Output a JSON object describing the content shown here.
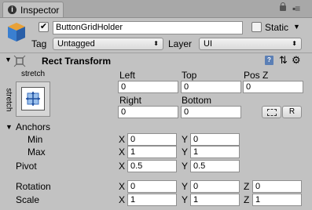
{
  "window": {
    "tab_title": "Inspector",
    "tab_icon": "info-icon",
    "menu_icon": "kebab-menu-icon"
  },
  "gameobject": {
    "active": true,
    "name": "ButtonGridHolder",
    "static_label": "Static",
    "static_checked": false,
    "tag_label": "Tag",
    "tag_value": "Untagged",
    "layer_label": "Layer",
    "layer_value": "UI"
  },
  "rect_transform": {
    "title": "Rect Transform",
    "anchor_preset_h": "stretch",
    "anchor_preset_v": "stretch",
    "headers": {
      "left": "Left",
      "top": "Top",
      "posz": "Pos Z",
      "right": "Right",
      "bottom": "Bottom"
    },
    "values": {
      "left": "0",
      "top": "0",
      "posz": "0",
      "right": "0",
      "bottom": "0"
    },
    "raw_button": "R",
    "anchors": {
      "label": "Anchors",
      "min_label": "Min",
      "min_x": "0",
      "min_y": "0",
      "max_label": "Max",
      "max_x": "1",
      "max_y": "1"
    },
    "pivot": {
      "label": "Pivot",
      "x": "0.5",
      "y": "0.5"
    },
    "rotation": {
      "label": "Rotation",
      "x": "0",
      "y": "0",
      "z": "0"
    },
    "scale": {
      "label": "Scale",
      "x": "1",
      "y": "1",
      "z": "1"
    },
    "axis": {
      "x": "X",
      "y": "Y",
      "z": "Z"
    }
  }
}
